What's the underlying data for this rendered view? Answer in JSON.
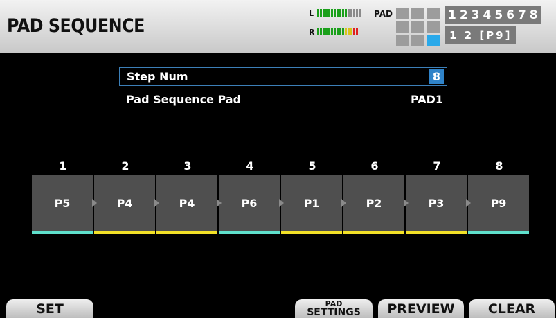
{
  "header": {
    "title": "PAD SEQUENCE",
    "meter_left_label": "L",
    "meter_right_label": "R",
    "pad_label": "PAD",
    "bank_numbers": "12345678",
    "bank_row2": "1 2 [P9]"
  },
  "params": {
    "step_num": {
      "label": "Step Num",
      "value": "8"
    },
    "pad_sequence_pad": {
      "label": "Pad Sequence Pad",
      "value": "PAD1"
    }
  },
  "steps": [
    {
      "num": "1",
      "pad": "P5",
      "color": "#5fe0cc"
    },
    {
      "num": "2",
      "pad": "P4",
      "color": "#f2e027"
    },
    {
      "num": "3",
      "pad": "P4",
      "color": "#f2e027"
    },
    {
      "num": "4",
      "pad": "P6",
      "color": "#5fe0cc"
    },
    {
      "num": "5",
      "pad": "P1",
      "color": "#f2e027"
    },
    {
      "num": "6",
      "pad": "P2",
      "color": "#f2e027"
    },
    {
      "num": "7",
      "pad": "P3",
      "color": "#f2e027"
    },
    {
      "num": "8",
      "pad": "P9",
      "color": "#5fe0cc"
    }
  ],
  "function_buttons": {
    "set": "SET",
    "pad_settings_line1": "PAD",
    "pad_settings_line2": "SETTINGS",
    "preview": "PREVIEW",
    "clear": "CLEAR"
  },
  "colors": {
    "selection_accent": "#2f83c9",
    "pad_active": "#29a9ea",
    "meter_green": "#1aa01a",
    "meter_yellow": "#d8c41a",
    "meter_red": "#e02020"
  }
}
